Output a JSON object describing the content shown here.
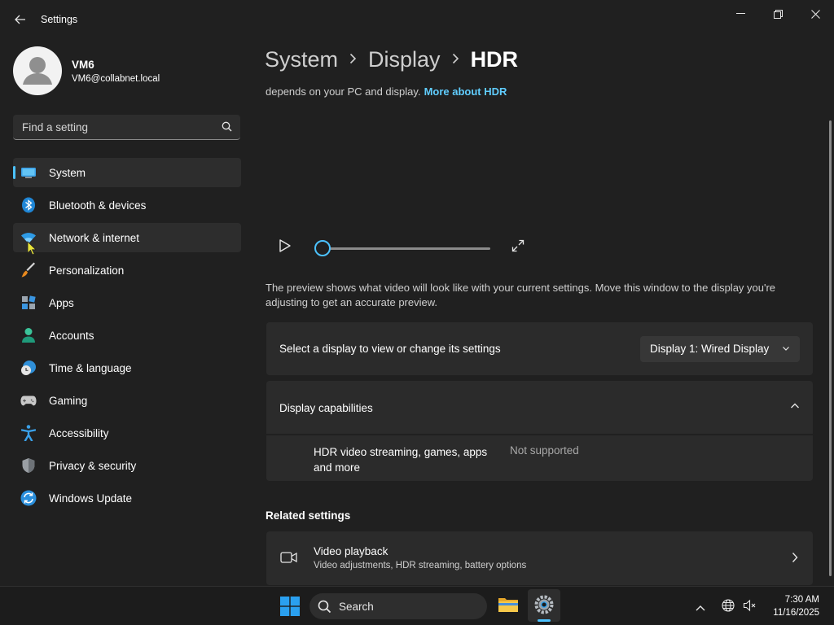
{
  "window": {
    "title": "Settings",
    "controls": [
      "minimize-icon",
      "restore-icon",
      "close-icon"
    ]
  },
  "profile": {
    "name": "VM6",
    "email": "VM6@collabnet.local"
  },
  "search": {
    "placeholder": "Find a setting"
  },
  "sidebar": {
    "items": [
      {
        "label": "System",
        "icon": "system-icon",
        "active": true
      },
      {
        "label": "Bluetooth & devices",
        "icon": "bluetooth-icon"
      },
      {
        "label": "Network & internet",
        "icon": "wifi-icon",
        "hover": true
      },
      {
        "label": "Personalization",
        "icon": "brush-icon"
      },
      {
        "label": "Apps",
        "icon": "apps-icon"
      },
      {
        "label": "Accounts",
        "icon": "accounts-icon"
      },
      {
        "label": "Time & language",
        "icon": "globe-clock-icon"
      },
      {
        "label": "Gaming",
        "icon": "gamepad-icon"
      },
      {
        "label": "Accessibility",
        "icon": "accessibility-icon"
      },
      {
        "label": "Privacy & security",
        "icon": "shield-icon"
      },
      {
        "label": "Windows Update",
        "icon": "update-icon"
      }
    ]
  },
  "breadcrumb": {
    "items": [
      "System",
      "Display"
    ],
    "current": "HDR"
  },
  "hdr": {
    "description": "depends on your PC and display.",
    "link": "More about HDR"
  },
  "player": {
    "progress": 0
  },
  "preview_note": "The preview shows what video will look like with your current settings. Move this window to the display you're adjusting to get an accurate preview.",
  "display_select": {
    "label": "Select a display to view or change its settings",
    "value": "Display 1: Wired Display"
  },
  "capabilities": {
    "title": "Display capabilities",
    "items": [
      {
        "name": "HDR video streaming, games, apps and more",
        "status": "Not supported"
      }
    ]
  },
  "related": {
    "heading": "Related settings",
    "video": {
      "title": "Video playback",
      "subtitle": "Video adjustments, HDR streaming, battery options"
    }
  },
  "taskbar": {
    "search_label": "Search",
    "time": "7:30 AM",
    "date": "11/16/2025"
  },
  "colors": {
    "accent": "#4cc2ff",
    "link": "#60cdff",
    "background": "#202020",
    "card": "#2b2b2b"
  }
}
